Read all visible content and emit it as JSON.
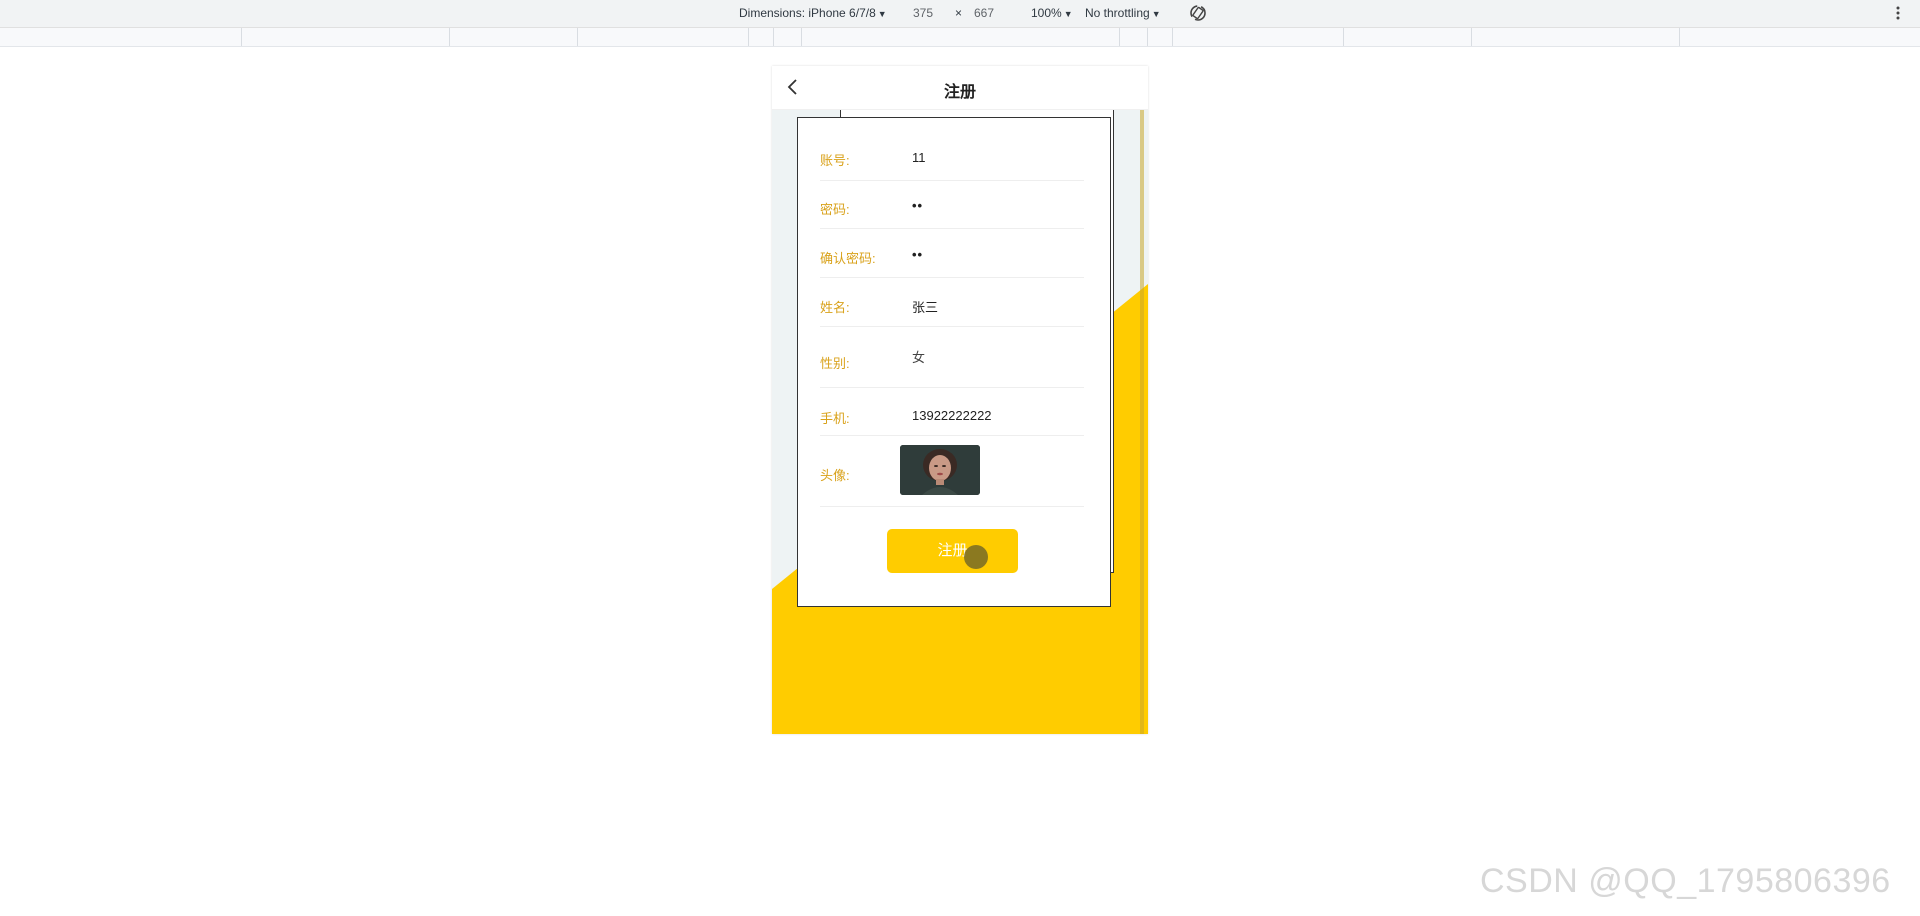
{
  "devtools": {
    "dimensions_label": "Dimensions: iPhone 6/7/8",
    "width_value": "375",
    "times_sign": "×",
    "height_value": "667",
    "zoom_label": "100%",
    "throttling_label": "No throttling"
  },
  "header": {
    "title": "注册"
  },
  "form": {
    "fields": [
      {
        "label": "账号:",
        "value": "11"
      },
      {
        "label": "密码:",
        "value": "••"
      },
      {
        "label": "确认密码:",
        "value": "••"
      },
      {
        "label": "姓名:",
        "value": "张三"
      },
      {
        "label": "性别:",
        "value": "女"
      },
      {
        "label": "手机:",
        "value": "13922222222"
      },
      {
        "label": "头像:",
        "value": ""
      }
    ],
    "submit_label": "注册"
  },
  "colors": {
    "accent_yellow": "#ffcc00",
    "label_gold": "#d9a21b",
    "page_bg": "#eef3f4"
  },
  "watermark": "CSDN @QQ_1795806396"
}
